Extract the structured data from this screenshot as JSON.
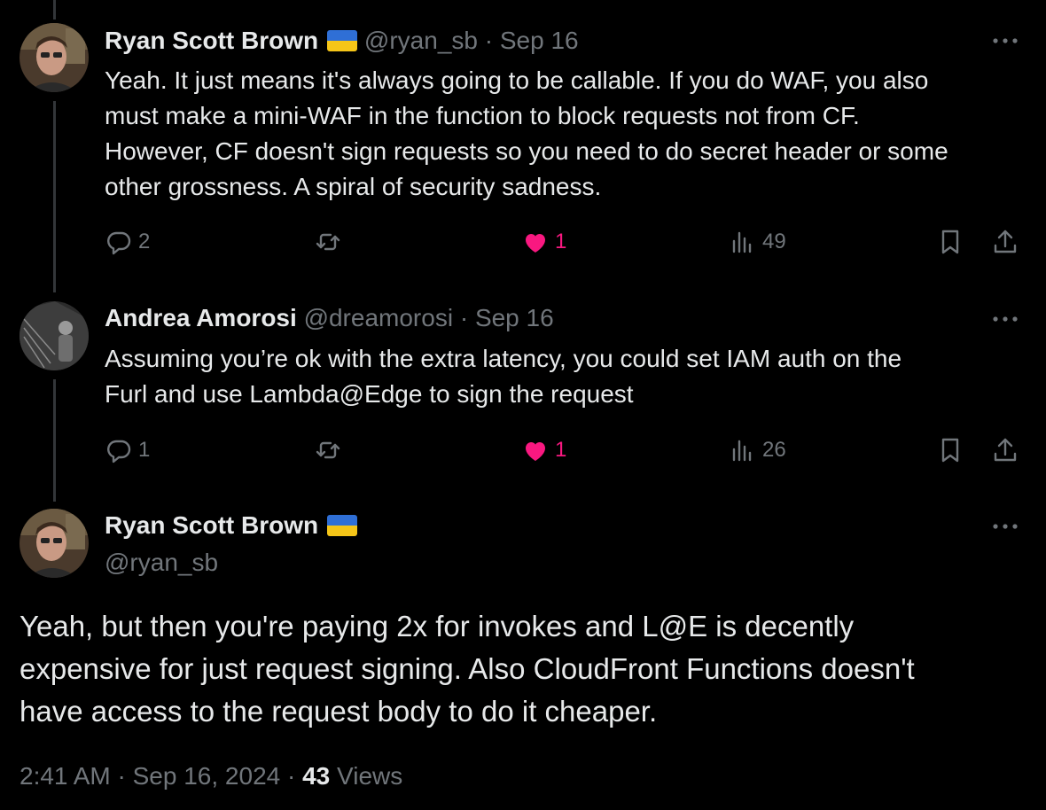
{
  "replies": [
    {
      "author_name": "Ryan Scott Brown",
      "handle": "@ryan_sb",
      "separator": "·",
      "date": "Sep 16",
      "lines": [
        "Yeah. It just means it's always going to be callable. If you do WAF, you also",
        "must make a mini-WAF in the function to block requests not from CF.",
        "However, CF doesn't sign requests so you need to do secret header or some",
        "other grossness. A spiral of security sadness."
      ],
      "reply_count": "2",
      "repost_count": "",
      "like_count": "1",
      "view_count": "49"
    },
    {
      "author_name": "Andrea Amorosi",
      "handle": "@dreamorosi",
      "separator": "·",
      "date": "Sep 16",
      "lines": [
        "Assuming you’re ok with the extra latency, you could set IAM auth on the",
        "Furl and use Lambda@Edge to sign the request"
      ],
      "reply_count": "1",
      "repost_count": "",
      "like_count": "1",
      "view_count": "26"
    }
  ],
  "main_tweet": {
    "author_name": "Ryan Scott Brown",
    "handle": "@ryan_sb",
    "lines": [
      "Yeah, but then you're paying 2x for invokes and L@E is decently",
      "expensive for just request signing. Also CloudFront Functions doesn't",
      "have access to the request body to do it cheaper."
    ],
    "time": "2:41 AM",
    "date": "Sep 16, 2024",
    "separator": "·",
    "views_count": "43",
    "views_label": "Views"
  },
  "icons": {
    "reply": "reply-icon",
    "repost": "repost-icon",
    "like": "heart-icon",
    "views": "views-icon",
    "bookmark": "bookmark-icon",
    "share": "share-icon",
    "more": "more-icon",
    "flag": "ukraine-flag-icon"
  },
  "colors": {
    "background": "#000000",
    "text": "#e7e9ea",
    "muted": "#71767b",
    "like": "#f91880",
    "thread_line": "#333639"
  }
}
